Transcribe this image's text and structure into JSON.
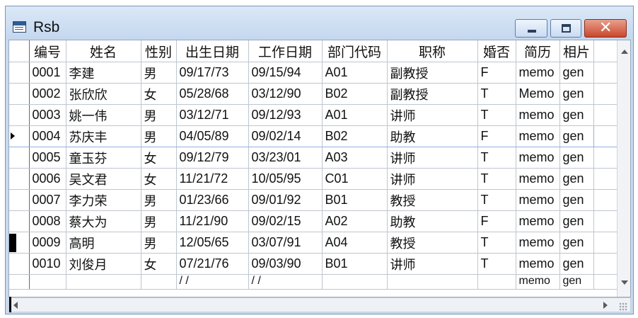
{
  "window": {
    "title": "Rsb"
  },
  "controls": {
    "minimize": "minimize",
    "maximize": "maximize",
    "close": "✕"
  },
  "columns": [
    "编号",
    "姓名",
    "性别",
    "出生日期",
    "工作日期",
    "部门代码",
    "职称",
    "婚否",
    "简历",
    "相片"
  ],
  "rows": [
    [
      "0001",
      "李建",
      "男",
      "09/17/73",
      "09/15/94",
      "A01",
      "副教授",
      "F",
      "memo",
      "gen"
    ],
    [
      "0002",
      "张欣欣",
      "女",
      "05/28/68",
      "03/12/90",
      "B02",
      "副教授",
      "T",
      "Memo",
      "gen"
    ],
    [
      "0003",
      "姚一伟",
      "男",
      "03/12/71",
      "09/12/93",
      "A01",
      "讲师",
      "T",
      "memo",
      "gen"
    ],
    [
      "0004",
      "苏庆丰",
      "男",
      "04/05/89",
      "09/02/14",
      "B02",
      "助教",
      "F",
      "memo",
      "gen"
    ],
    [
      "0005",
      "童玉芬",
      "女",
      "09/12/79",
      "03/23/01",
      "A03",
      "讲师",
      "T",
      "memo",
      "gen"
    ],
    [
      "0006",
      "吴文君",
      "女",
      "11/21/72",
      "10/05/95",
      "C01",
      "讲师",
      "T",
      "memo",
      "gen"
    ],
    [
      "0007",
      "李力荣",
      "男",
      "01/23/66",
      "09/01/92",
      "B01",
      "教授",
      "T",
      "memo",
      "gen"
    ],
    [
      "0008",
      "蔡大为",
      "男",
      "11/21/90",
      "09/02/15",
      "A02",
      "助教",
      "F",
      "memo",
      "gen"
    ],
    [
      "0009",
      "高明",
      "男",
      "12/05/65",
      "03/07/91",
      "A04",
      "教授",
      "T",
      "memo",
      "gen"
    ],
    [
      "0010",
      "刘俊月",
      "女",
      "07/21/76",
      "09/03/90",
      "B01",
      "讲师",
      "T",
      "memo",
      "gen"
    ]
  ],
  "current_row": 3,
  "marked_row": 8,
  "partial_row": [
    "",
    "",
    "",
    "/ /",
    "/ /",
    "",
    "",
    "",
    "memo",
    "gen"
  ]
}
